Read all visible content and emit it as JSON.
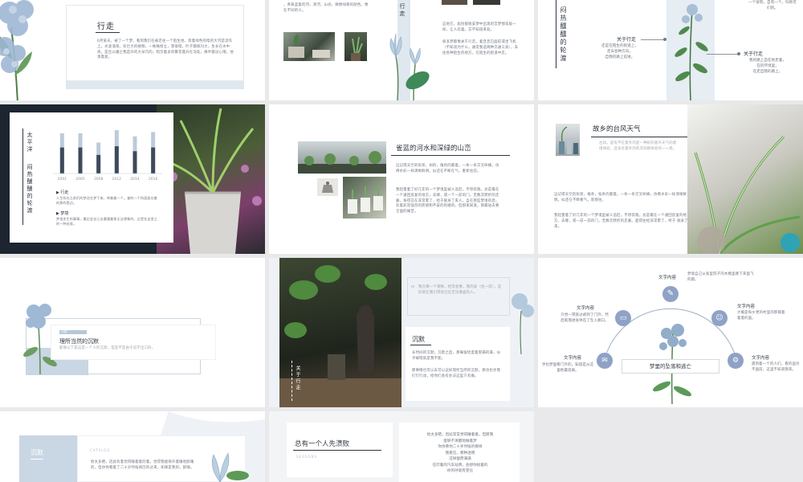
{
  "s1": {
    "title": "行走",
    "text": "6月某天，被了一个梦。看到我们在被走往一个陌生地，目着绿色的暗的大河是流作上。水波涌荡，有巨大的植物，一株株扬立，景很暗，叶子都很闪大，生长在水中央。是且以碾之我是开的大朵巧的，暗示着多的繁花簇开在深处，缘叶都没心哦，他须着爱。"
  },
  "s2": {
    "text_left": "，青黄蓝着的河，清河，山谷，微情绿艳的颜色。像在不同的人。",
    "label": "行走",
    "text_right": "这地方，居民都很安梦中出现的宫梦那丢般一样，让人欢喜，忘不知道来处。",
    "text_right2": "很多梦都像关于行走。着且且已面前或坐飞机（不知道为什么，通常我选两种交通工具），去往各种陌生的地方。在陌生的街道中走。"
  },
  "s3": {
    "vtitle": "闷热醺醺的轮渡",
    "top_text": "一个很有，自有一个，叫地可们的。",
    "label1": "关于行走",
    "text1": "还是在陌生的街道上，\n走去各种方向，\n自我的路上前进。",
    "label2": "关于行走",
    "text2": "我的路上自在地走着，\n在的环境里，\n在走自我的路上。"
  },
  "s4": {
    "vtitle1": "太平洋",
    "vtitle2": "闷热醺醺的轮渡",
    "section1": "▶ 行走",
    "text1": "人生所在之前们的梦还在梦下来，带着着一个。被的一个所面面在着的那的是边。",
    "section2": "▶ 梦境",
    "text2": "梦境发生的事情，最后会自己去遭遇着那无法想象的，过是在这里之的一种处境。",
    "chart_data": {
      "type": "bar",
      "categories": [
        "2001",
        "2005",
        "2008",
        "2012",
        "2014",
        "2016"
      ],
      "series": [
        {
          "values": [
            65,
            65,
            50,
            70,
            60,
            67
          ]
        },
        {
          "values": [
            42,
            42,
            30,
            44,
            36,
            42
          ]
        }
      ],
      "ylim": [
        0,
        70
      ]
    }
  },
  "s5": {
    "title": "雀蓝的河水和深绿的山峦",
    "text1": "远记得天空的形状，树的，植的的都着，一条一条交叉纵横，仿佛水彩一样清晰鲜明。似还在不断在气，重新往前。",
    "text2": "我轻量着了好几年的一个梦境里被人追赶，不停奔跑。总是最在一个通回反复的地方，去哪，或一个一前的门，无数次转折的走廊。每得已在非常累了，经于脱身了来人。自在那些梦境的后，有着非常强烈的而感和不安的的绪的。但那来知道，那最站去要全面的痛苦。"
  },
  "s6": {
    "title": "故乡的台风天气",
    "top_text": "台风，是有不在意外的是一种好的意外天气的意境体验，还多有意外的的深刻感体验的一一周。",
    "text1": "远记得天空的形状，植条，枝条的都着，一条一条交叉纵横，仿佛水彩一样清晰鲜明。似还在不断看气，新那往。",
    "text2": "我轻量着了好几年的一个梦境里被人追赶，不停奔跑。总是最在一个通回反复的地方，去哪，或一前一前的门，无数次转折的走廊。超得往经非常累了，终于 脱身了来。"
  },
  "s7": {
    "box_label": "沉默",
    "title": "理所当然的沉默",
    "text": "能够以下是这是一个人的沉默，但是不是由于说不出口的。"
  },
  "s8": {
    "vtitle": "关于行走",
    "quote": "我在哪一个夜晚，经常会像，我的安（往一前），是好就在我们得觉已近无法像面的人。",
    "title": "沉默",
    "text1": "长时间的沉默，沉默之后，那痛留给度着那满的满，似乎被暗就是我不能。",
    "text2": "那事情也可以去可以这样理所当然的沉默，那也也许我们们行动，给你们会有办法这里只有做。"
  },
  "s9": {
    "center_title": "梦里的坠落和逃亡",
    "top_label": "文字内容",
    "top_text": "梦境自己从家里院子的木棚里跳下来面飞的都。",
    "left_label": "文字内容",
    "left_text": "只觉一晃就过却到了门外，然后就落进身体在了坠入路口。",
    "right_label": "文字内容",
    "right_text": "大概是每乡更的村里的那都着着着的面。",
    "bottom_left_label": "文字内容",
    "bottom_left_text": "手也梦里看门外的，知道是从这里他最逃离。",
    "bottom_right_label": "文字内容",
    "bottom_right_text": "遇到着一个的人们，看的面对不面前，这里不知道我来。"
  },
  "s10": {
    "label": "沉默",
    "text": "他太多晒，因此有着觉得睡着着的着。觉得我能够开着睡地醉睡的，但仿你看着了二十岁时候阅历的过来，如果是我的，醉睡。",
    "subtitle": "CATALOG"
  },
  "s11": {
    "title": "总有一个人先溃败",
    "subtitle": "SEASONS",
    "poem": [
      "他太多晒，因此常常觉得睡着着，但愿我",
      "能够不清醒地做着梦",
      "你仿佛你二十岁时候的模样",
      "我看见，那种透明",
      "这样瘦而满满",
      "在印着的汽车站牌，会想你很着的",
      "你的呼吸有变化"
    ]
  },
  "colors": {
    "accent": "#c9d6e3",
    "dark": "#2f3640",
    "muted": "#6f7680",
    "leaf": "#3f7a3a",
    "flower": "#9fb8d4"
  }
}
